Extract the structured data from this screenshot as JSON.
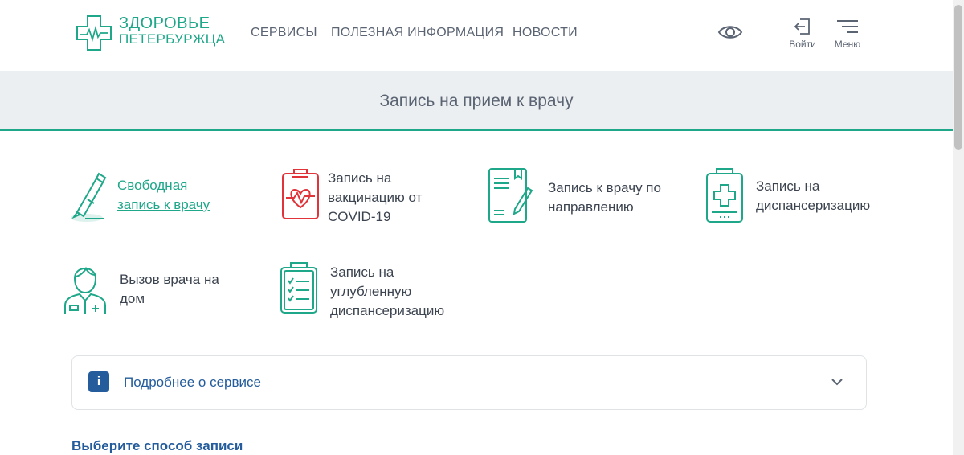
{
  "header": {
    "logo": {
      "line1": "ЗДОРОВЬЕ",
      "line2": "ПЕТЕРБУРЖЦА"
    },
    "nav": [
      "СЕРВИСЫ",
      "ПОЛЕЗНАЯ ИНФОРМАЦИЯ",
      "НОВОСТИ"
    ],
    "login_label": "Войти",
    "menu_label": "Меню"
  },
  "page_title": "Запись на прием к врачу",
  "services": [
    {
      "label": "Свободная запись к врачу",
      "icon": "pen-icon",
      "active": true
    },
    {
      "label": "Запись на вакцинацию от COVID-19",
      "icon": "clipboard-heartbeat-icon",
      "active": false
    },
    {
      "label": "Запись к врачу по направлению",
      "icon": "referral-document-icon",
      "active": false
    },
    {
      "label": "Запись на диспансеризацию",
      "icon": "clipboard-cross-icon",
      "active": false
    },
    {
      "label": "Вызов врача на дом",
      "icon": "doctor-icon",
      "active": false
    },
    {
      "label": "Запись на углубленную диспансеризацию",
      "icon": "clipboard-checklist-icon",
      "active": false
    }
  ],
  "info_panel": {
    "badge": "i",
    "label": "Подробнее о сервисе"
  },
  "section_title": "Выберите способ записи",
  "colors": {
    "accent": "#1fa789",
    "accent_red": "#e0343a",
    "link_blue": "#245c9c",
    "text": "#3c4450",
    "band": "#eceff1"
  }
}
